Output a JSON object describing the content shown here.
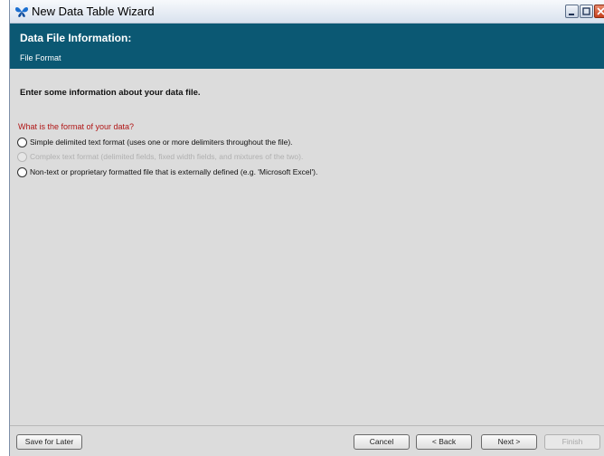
{
  "window": {
    "title": "New Data Table Wizard"
  },
  "header": {
    "title": "Data File Information:",
    "subtitle": "File Format"
  },
  "content": {
    "intro": "Enter some information about your data file.",
    "question": "What is the format of your data?",
    "options": [
      {
        "label": "Simple delimited text format (uses one or more delimiters throughout the file).",
        "enabled": true,
        "selected": false
      },
      {
        "label": "Complex text format (delimited fields, fixed width fields, and mixtures of the two).",
        "enabled": false,
        "selected": false
      },
      {
        "label": "Non-text or proprietary formatted file that is externally defined (e.g. 'Microsoft Excel').",
        "enabled": true,
        "selected": false
      }
    ]
  },
  "footer": {
    "save_for_later": "Save for Later",
    "cancel": "Cancel",
    "back": "< Back",
    "next": "Next >",
    "finish": "Finish"
  },
  "colors": {
    "header_bg": "#0b5873",
    "question": "#b01515"
  }
}
